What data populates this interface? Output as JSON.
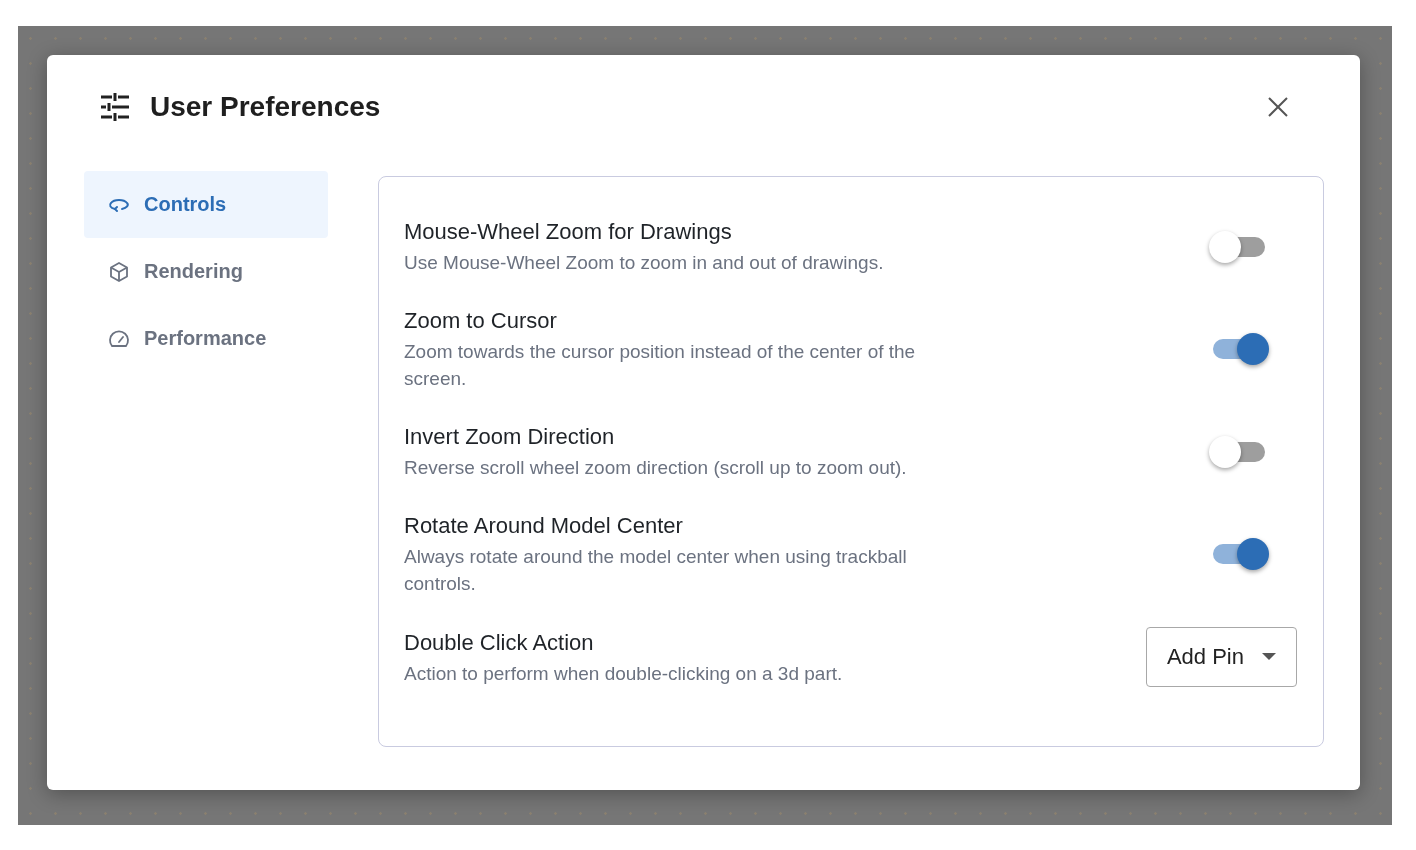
{
  "dialog": {
    "title": "User Preferences"
  },
  "nav": [
    {
      "label": "Controls",
      "selected": true
    },
    {
      "label": "Rendering",
      "selected": false
    },
    {
      "label": "Performance",
      "selected": false
    }
  ],
  "settings": [
    {
      "kind": "toggle",
      "title": "Mouse-Wheel Zoom for Drawings",
      "description": "Use Mouse-Wheel Zoom to zoom in and out of drawings.",
      "on": false
    },
    {
      "kind": "toggle",
      "title": "Zoom to Cursor",
      "description": "Zoom towards the cursor position instead of the center of the screen.",
      "on": true
    },
    {
      "kind": "toggle",
      "title": "Invert Zoom Direction",
      "description": "Reverse scroll wheel zoom direction (scroll up to zoom out).",
      "on": false
    },
    {
      "kind": "toggle",
      "title": "Rotate Around Model Center",
      "description": "Always rotate around the model center when using trackball controls.",
      "on": true
    },
    {
      "kind": "select",
      "title": "Double Click Action",
      "description": "Action to perform when double-clicking on a 3d part.",
      "value": "Add Pin"
    }
  ]
}
